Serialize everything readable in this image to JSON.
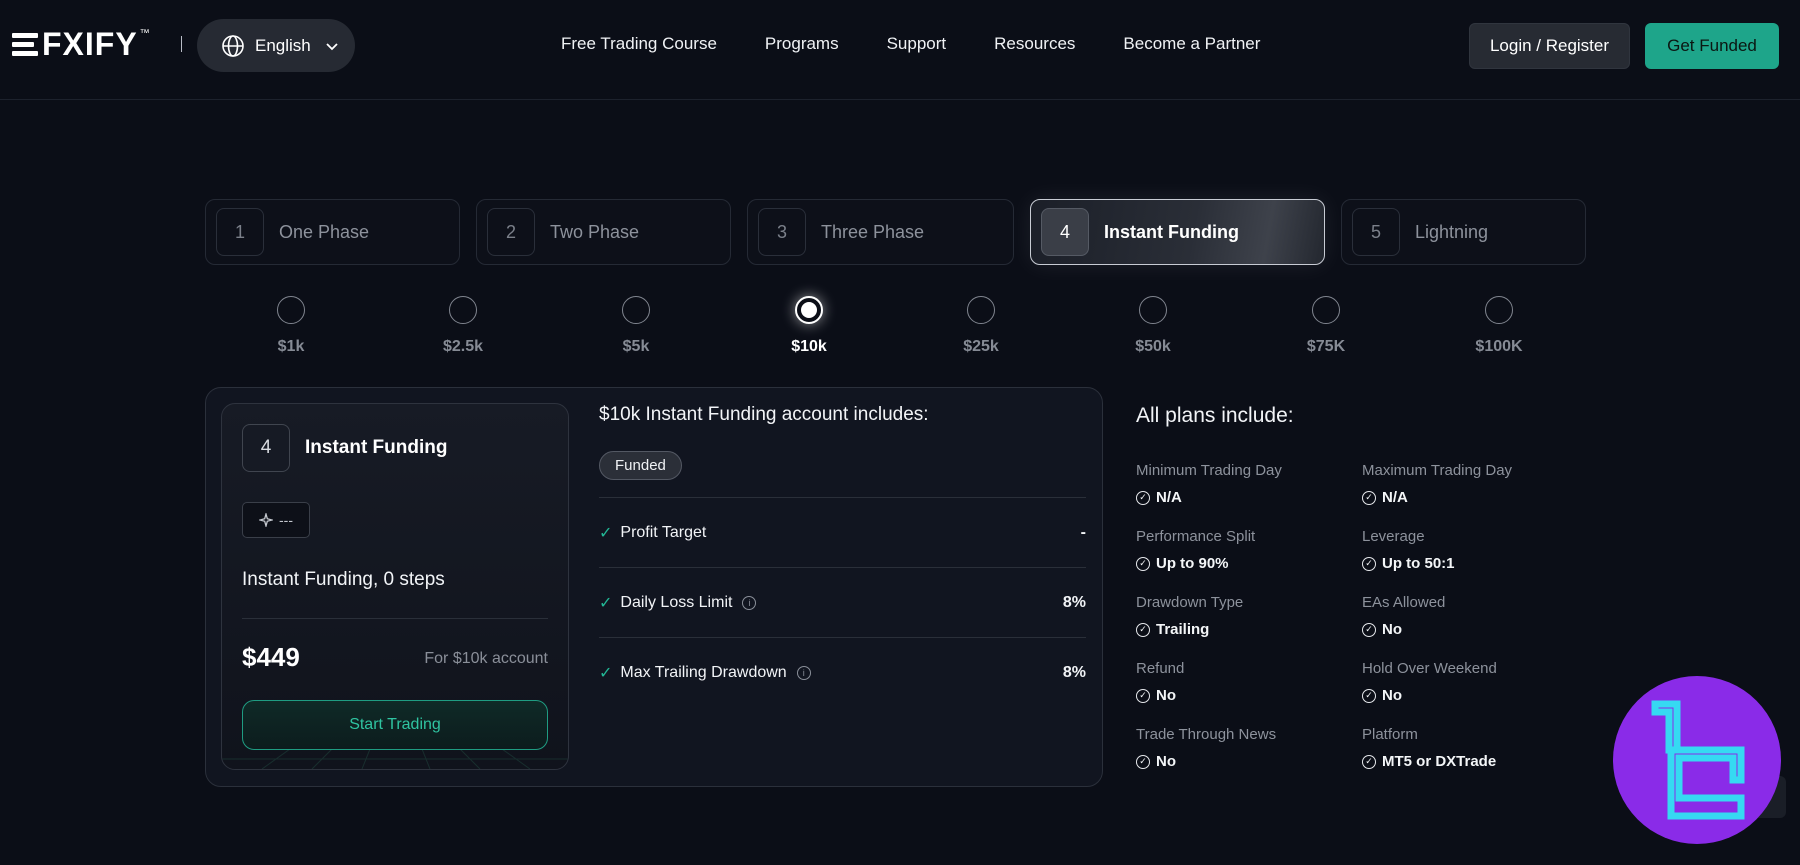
{
  "header": {
    "logo_text": "FXIFY",
    "logo_tm": "™",
    "language": "English",
    "nav": [
      "Free Trading Course",
      "Programs",
      "Support",
      "Resources",
      "Become a Partner"
    ],
    "login_label": "Login / Register",
    "cta_label": "Get Funded"
  },
  "tabs": [
    {
      "num": "1",
      "label": "One Phase"
    },
    {
      "num": "2",
      "label": "Two Phase"
    },
    {
      "num": "3",
      "label": "Three Phase"
    },
    {
      "num": "4",
      "label": "Instant Funding",
      "active": true
    },
    {
      "num": "5",
      "label": "Lightning"
    }
  ],
  "sizes": [
    "$1k",
    "$2.5k",
    "$5k",
    "$10k",
    "$25k",
    "$50k",
    "$75K",
    "$100K"
  ],
  "selected_size": "$10k",
  "card": {
    "num": "4",
    "title": "Instant Funding",
    "tag": "---",
    "steps": "Instant Funding, 0 steps",
    "price": "$449",
    "for_text": "For $10k account",
    "button": "Start Trading"
  },
  "includes": {
    "title": "$10k Instant Funding account includes:",
    "badge": "Funded",
    "rows": [
      {
        "label": "Profit Target",
        "value": "-",
        "info": false
      },
      {
        "label": "Daily Loss Limit",
        "value": "8%",
        "info": true
      },
      {
        "label": "Max Trailing Drawdown",
        "value": "8%",
        "info": true
      }
    ]
  },
  "plans": {
    "title": "All plans include:",
    "items": [
      {
        "key": "Minimum Trading Day",
        "value": "N/A"
      },
      {
        "key": "Maximum Trading Day",
        "value": "N/A"
      },
      {
        "key": "Performance Split",
        "value": "Up to 90%"
      },
      {
        "key": "Leverage",
        "value": "Up to 50:1"
      },
      {
        "key": "Drawdown Type",
        "value": "Trailing"
      },
      {
        "key": "EAs Allowed",
        "value": "No"
      },
      {
        "key": "Refund",
        "value": "No"
      },
      {
        "key": "Hold Over Weekend",
        "value": "No"
      },
      {
        "key": "Trade Through News",
        "value": "No"
      },
      {
        "key": "Platform",
        "value": "MT5 or DXTrade"
      }
    ]
  },
  "colors": {
    "background": "#0b0e17",
    "accent": "#1ea58a",
    "watermark": "#8a2be8"
  }
}
